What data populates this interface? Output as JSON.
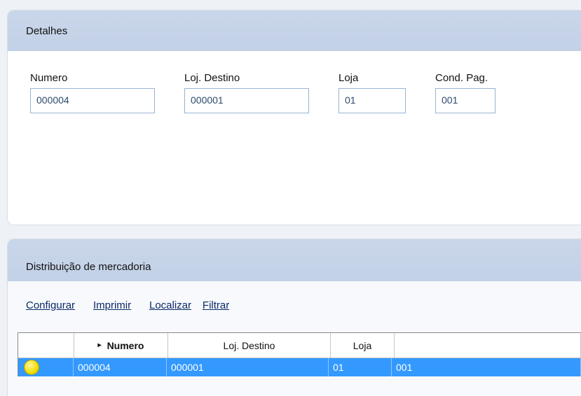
{
  "details": {
    "title": "Detalhes",
    "fields": [
      {
        "label": "Numero",
        "value": "000004"
      },
      {
        "label": "Loj. Destino",
        "value": "000001"
      },
      {
        "label": "Loja",
        "value": "01"
      },
      {
        "label": "Cond. Pag.",
        "value": "001"
      }
    ]
  },
  "distribution": {
    "title": "Distribuição de mercadoria",
    "toolbar": [
      "Configurar",
      "Imprimir",
      "Localizar",
      "Filtrar"
    ],
    "columns": [
      "",
      "Numero",
      "Loj. Destino",
      "Loja",
      ""
    ],
    "sorted_column_marker": "▸",
    "rows": [
      {
        "status": "yellow-circle-icon",
        "numero": "000004",
        "loj_destino": "000001",
        "loja": "01",
        "cond_pag": "001"
      }
    ],
    "selected_row_color": "#3399ff"
  }
}
